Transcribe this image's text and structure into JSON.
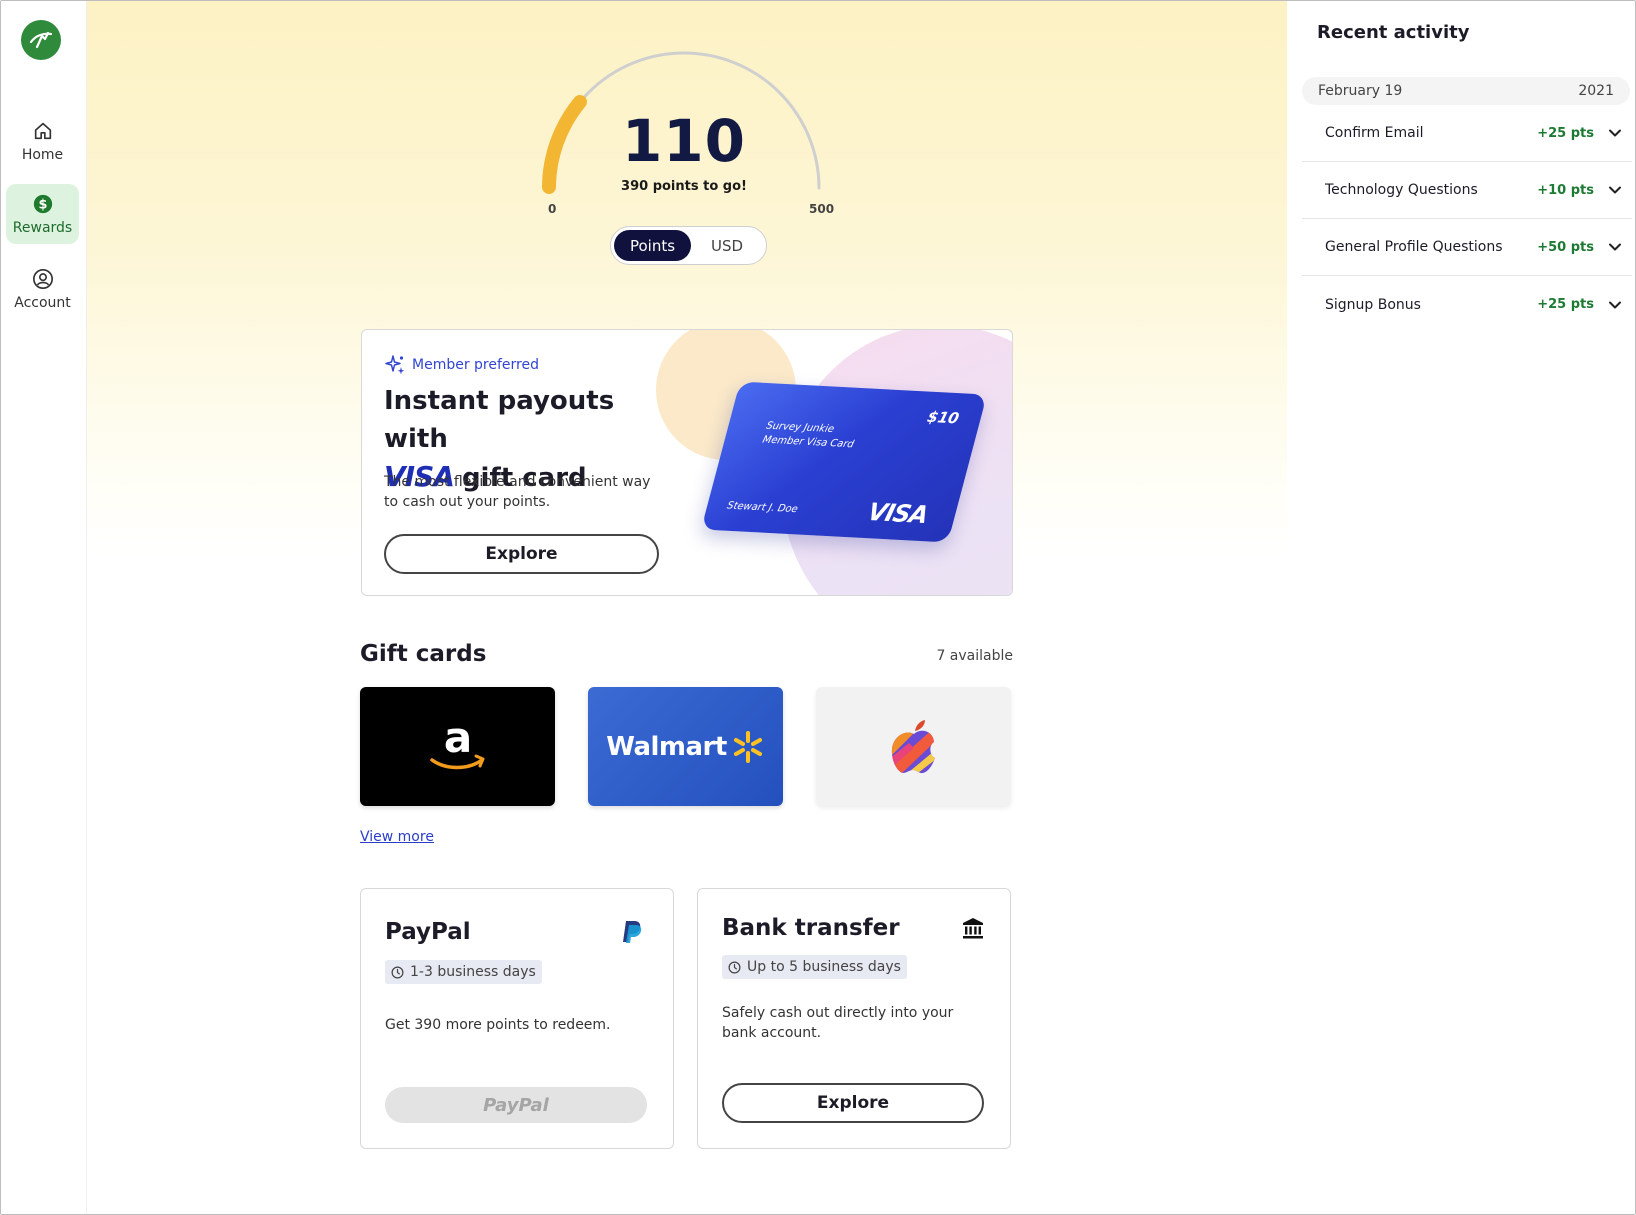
{
  "sidebar": {
    "items": [
      {
        "label": "Home",
        "icon": "home-icon",
        "active": false
      },
      {
        "label": "Rewards",
        "icon": "dollar-icon",
        "active": true
      },
      {
        "label": "Account",
        "icon": "user-icon",
        "active": false
      }
    ]
  },
  "gauge": {
    "value": "110",
    "subtitle": "390 points to go!",
    "min_label": "0",
    "max_label": "500",
    "progress_fraction": 0.22
  },
  "toggle": {
    "option_a": "Points",
    "option_b": "USD"
  },
  "promo": {
    "tag": "Member preferred",
    "title_line1": "Instant payouts with",
    "title_visa": "VISA",
    "title_line2": "gift card",
    "description": "The most flexible and convenient way to cash out your points.",
    "button": "Explore",
    "card": {
      "amount": "$10",
      "name": "Survey Junkie Member Visa Card",
      "holder": "Stewart J. Doe",
      "logo": "VISA"
    }
  },
  "gift_cards": {
    "title": "Gift cards",
    "count": "7 available",
    "cards": [
      {
        "brand": "amazon",
        "icon": "amazon-logo-icon"
      },
      {
        "brand": "walmart",
        "text": "Walmart"
      },
      {
        "brand": "apple",
        "icon": "apple-logo-icon"
      }
    ],
    "view_more": "View more"
  },
  "payouts": {
    "paypal": {
      "title": "PayPal",
      "badge": "1-3 business days",
      "description": "Get 390 more points to redeem.",
      "button": "PayPal"
    },
    "bank": {
      "title": "Bank transfer",
      "badge": "Up to 5 business days",
      "description": "Safely cash out directly into your bank account.",
      "button": "Explore"
    }
  },
  "recent_activity": {
    "title": "Recent activity",
    "date": "February 19",
    "year": "2021",
    "items": [
      {
        "label": "Confirm Email",
        "points": "+25 pts"
      },
      {
        "label": "Technology Questions",
        "points": "+10 pts"
      },
      {
        "label": "General Profile Questions",
        "points": "+50 pts"
      },
      {
        "label": "Signup Bonus",
        "points": "+25 pts"
      }
    ]
  },
  "colors": {
    "brand_green": "#2f8a3c",
    "navy": "#121a43",
    "visa_blue": "#1f2fb5",
    "points_green": "#1d7a33",
    "gauge_fill": "#f2b632"
  }
}
